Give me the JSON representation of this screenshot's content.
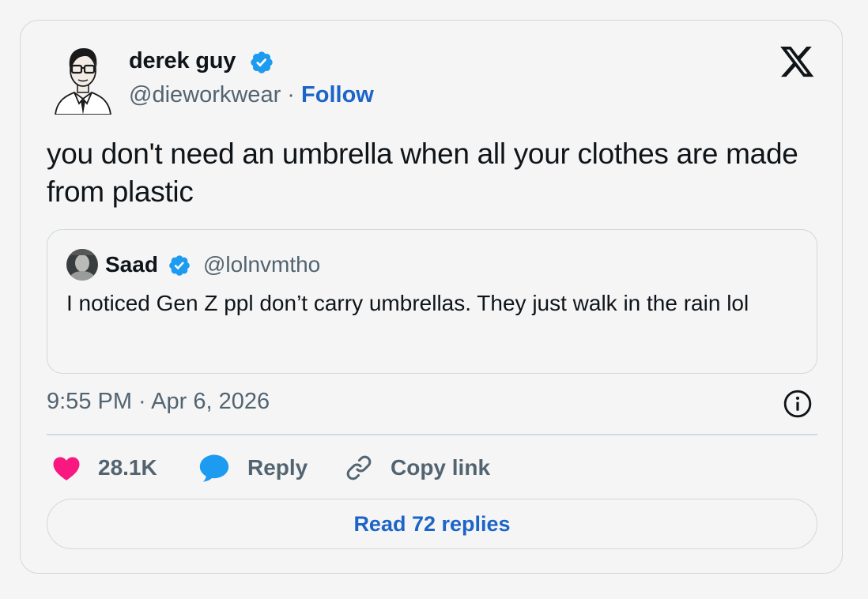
{
  "author": {
    "name": "derek guy",
    "handle": "@dieworkwear",
    "separator": "·",
    "follow_label": "Follow"
  },
  "tweet": {
    "text": "you don't need an umbrella when all your clothes are made from plastic",
    "timestamp": "9:55 PM · Apr 6, 2026"
  },
  "quote": {
    "name": "Saad",
    "handle": "@lolnvmtho",
    "text": "I noticed Gen Z ppl don’t carry umbrellas. They just walk in the rain lol"
  },
  "actions": {
    "likes_count": "28.1K",
    "reply_label": "Reply",
    "copy_label": "Copy link"
  },
  "read_replies_label": "Read 72 replies",
  "icons": {
    "verified": "verified-badge-icon",
    "x_logo": "x-logo-icon",
    "info": "info-icon",
    "like": "heart-icon",
    "reply": "speech-bubble-icon",
    "copy": "link-icon"
  },
  "colors": {
    "link_blue": "#1d64c8",
    "verified_blue": "#1d9bf0",
    "like_pink": "#f91880",
    "text_primary": "#0f1419",
    "text_secondary": "#536471",
    "border": "#cfd9de"
  }
}
